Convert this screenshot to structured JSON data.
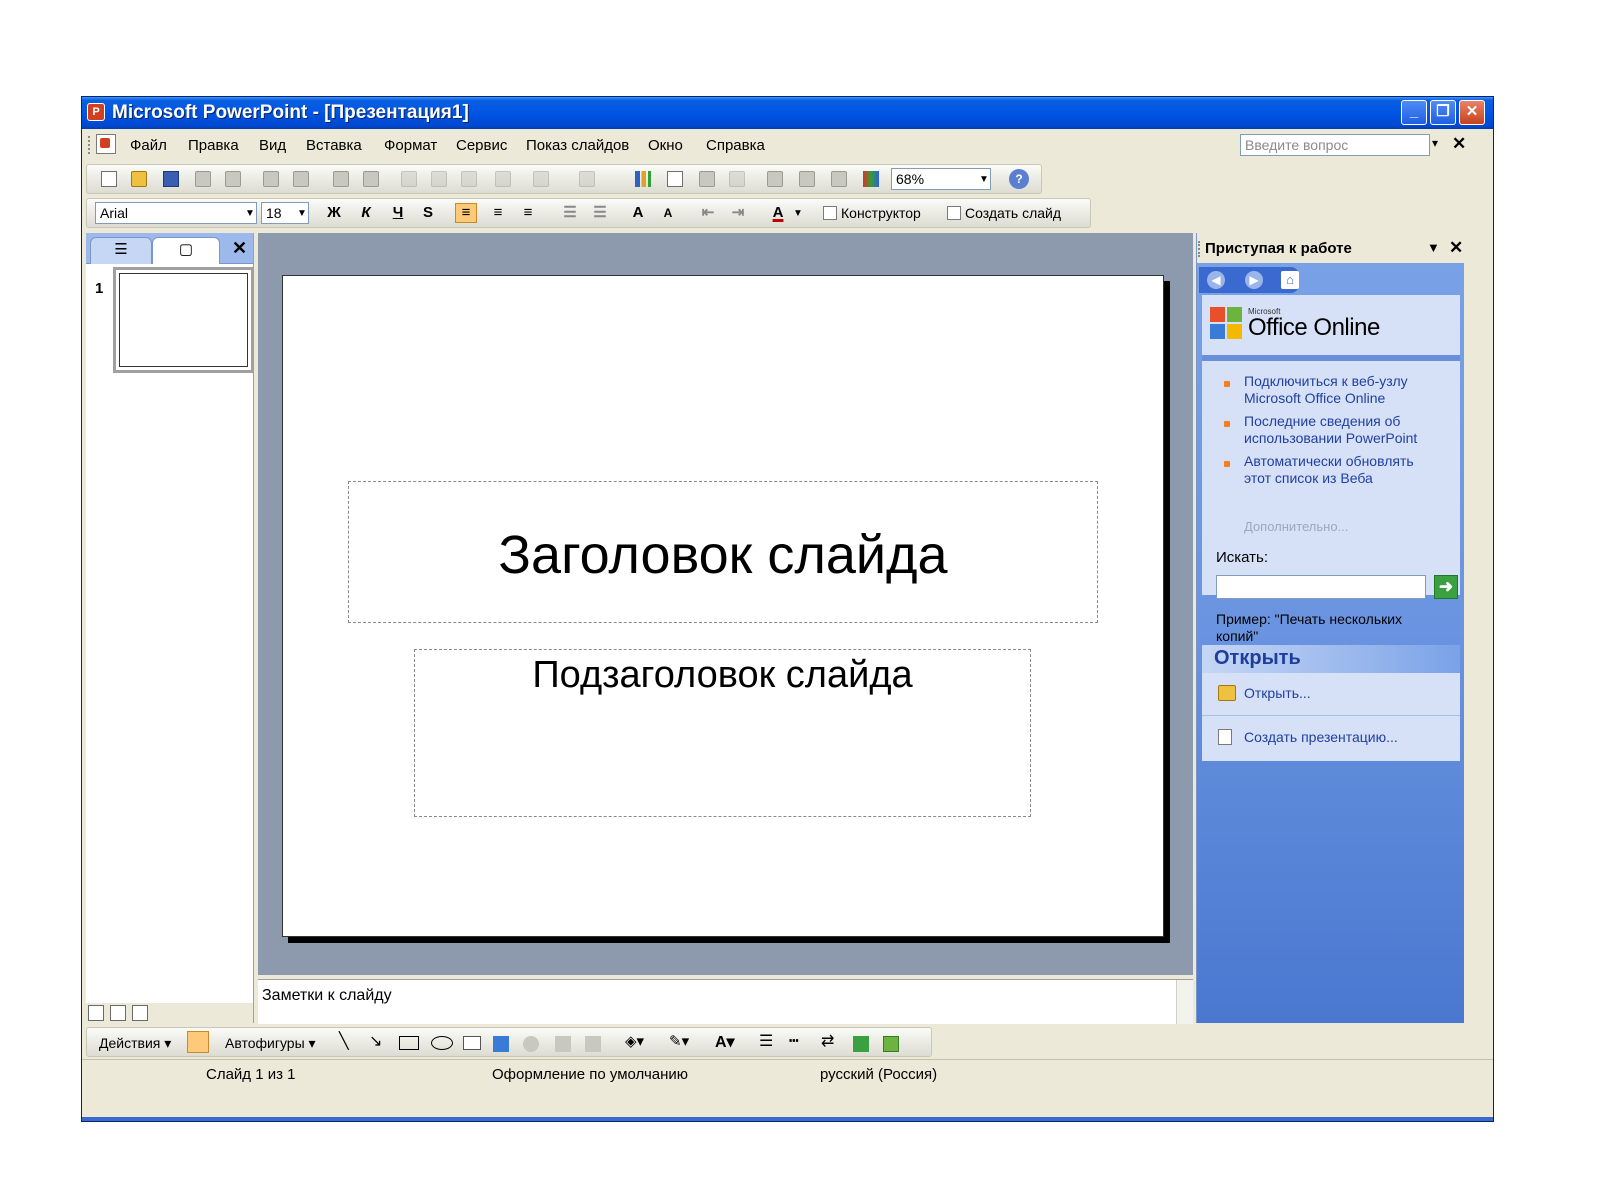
{
  "window": {
    "title": "Microsoft PowerPoint - [Презентация1]",
    "app_icon_letter": "P",
    "controls": {
      "minimize": "_",
      "restore": "❐",
      "close": "✕"
    }
  },
  "menu": {
    "items": [
      "Файл",
      "Правка",
      "Вид",
      "Вставка",
      "Формат",
      "Сервис",
      "Показ слайдов",
      "Окно",
      "Справка"
    ],
    "ask_placeholder": "Введите вопрос"
  },
  "toolbar_standard": {
    "zoom": "68%"
  },
  "toolbar_format": {
    "font": "Arial",
    "size": "18",
    "bold": "Ж",
    "italic": "К",
    "underline": "Ч",
    "shadow": "S",
    "designer": "Конструктор",
    "new_slide": "Создать слайд"
  },
  "outline_pane": {
    "tab_outline_icon": "outline-icon",
    "tab_slides_icon": "slides-icon",
    "slide_number": "1"
  },
  "slide": {
    "title": "Заголовок слайда",
    "subtitle": "Подзаголовок слайда"
  },
  "notes": {
    "placeholder": "Заметки к слайду"
  },
  "task_pane": {
    "title": "Приступая к работе",
    "office_small": "Microsoft",
    "office_brand": "Office Online",
    "links": [
      "Подключиться к веб-узлу Microsoft Office Online",
      "Последние сведения об использовании PowerPoint",
      "Автоматически обновлять этот список из Веба"
    ],
    "more": "Дополнительно...",
    "search_label": "Искать:",
    "example": "Пример: \"Печать нескольких копий\"",
    "open_section": "Открыть",
    "open_link": "Открыть...",
    "create_link": "Создать презентацию..."
  },
  "drawing_toolbar": {
    "actions": "Действия",
    "autoshapes": "Автофигуры"
  },
  "status": {
    "slide": "Слайд 1 из 1",
    "design": "Оформление по умолчанию",
    "language": "русский (Россия)"
  },
  "colors": {
    "title_bar": "#0055e5",
    "task_pane": "#6a94e0",
    "work_area": "#8d99ad",
    "highlight": "#ffc97a"
  }
}
